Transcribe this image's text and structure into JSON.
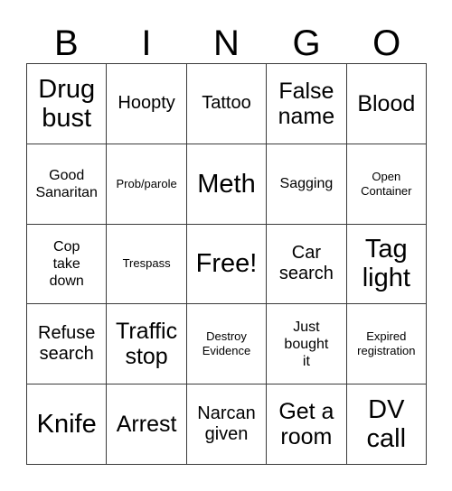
{
  "card": {
    "header_letters": [
      "B",
      "I",
      "N",
      "G",
      "O"
    ],
    "columns": 5,
    "rows": 5,
    "border_color": "#3a3a3a",
    "background_color": "#ffffff",
    "text_color": "#000000",
    "free_space_index": 12,
    "cells": [
      {
        "text": "Drug\nbust",
        "size": "xl"
      },
      {
        "text": "Hoopty",
        "size": "md"
      },
      {
        "text": "Tattoo",
        "size": "md"
      },
      {
        "text": "False\nname",
        "size": "lg"
      },
      {
        "text": "Blood",
        "size": "lg"
      },
      {
        "text": "Good\nSanaritan",
        "size": "sm"
      },
      {
        "text": "Prob/parole",
        "size": "xs"
      },
      {
        "text": "Meth",
        "size": "xl"
      },
      {
        "text": "Sagging",
        "size": "sm"
      },
      {
        "text": "Open\nContainer",
        "size": "xs"
      },
      {
        "text": "Cop\ntake\ndown",
        "size": "sm"
      },
      {
        "text": "Trespass",
        "size": "xs"
      },
      {
        "text": "Free!",
        "size": "xl"
      },
      {
        "text": "Car\nsearch",
        "size": "md"
      },
      {
        "text": "Tag\nlight",
        "size": "xl"
      },
      {
        "text": "Refuse\nsearch",
        "size": "md"
      },
      {
        "text": "Traffic\nstop",
        "size": "lg"
      },
      {
        "text": "Destroy\nEvidence",
        "size": "xs"
      },
      {
        "text": "Just\nbought\nit",
        "size": "sm"
      },
      {
        "text": "Expired\nregistration",
        "size": "xs"
      },
      {
        "text": "Knife",
        "size": "xl"
      },
      {
        "text": "Arrest",
        "size": "lg"
      },
      {
        "text": "Narcan\ngiven",
        "size": "md"
      },
      {
        "text": "Get a\nroom",
        "size": "lg"
      },
      {
        "text": "DV\ncall",
        "size": "xl"
      }
    ]
  }
}
